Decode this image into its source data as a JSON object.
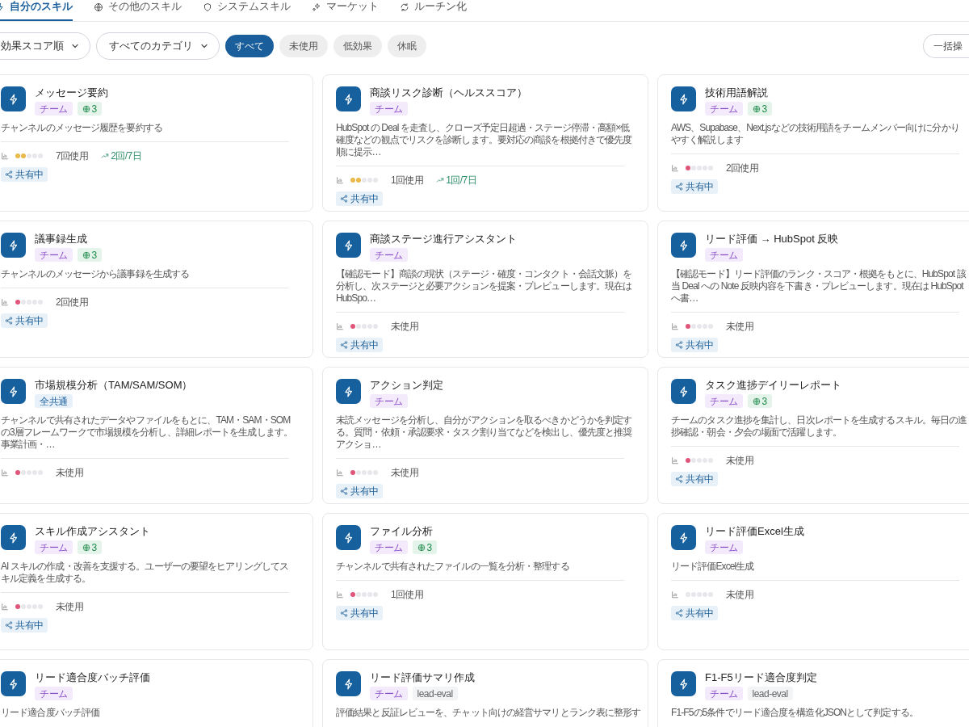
{
  "tabs": [
    {
      "label": "自分のスキル",
      "selected": true
    },
    {
      "label": "その他のスキル",
      "selected": false
    },
    {
      "label": "システムスキル",
      "selected": false
    },
    {
      "label": "マーケット",
      "selected": false
    },
    {
      "label": "ルーチン化",
      "selected": false
    }
  ],
  "toolbar": {
    "sort": {
      "value": "効果スコア順"
    },
    "category": {
      "value": "すべてのカテゴリ"
    },
    "chips": [
      {
        "label": "すべて",
        "selected": true
      },
      {
        "label": "未使用",
        "selected": false
      },
      {
        "label": "低効果",
        "selected": false
      },
      {
        "label": "休眠",
        "selected": false
      }
    ],
    "bulk_button": "一括操"
  },
  "cards": [
    {
      "name": "メッセージ要約",
      "tags": [
        {
          "kind": "team",
          "text": "チーム"
        },
        {
          "kind": "channels",
          "text": "3"
        }
      ],
      "description": "チャンネルのメッセージ履歴を要約する",
      "stars": 2,
      "usage": "7回使用",
      "trend": "2回/7日",
      "shared": true,
      "shared_label": "共有中"
    },
    {
      "name": "商談リスク診断（ヘルススコア）",
      "tags": [
        {
          "kind": "team",
          "text": "チーム"
        }
      ],
      "description": "HubSpot の Deal を走査し、クローズ予定日超過・ステージ停滞・高額×低確度などの観点でリスクを診断します。要対応の商談を根拠付きで優先度順に提示…",
      "stars": 2,
      "usage": "1回使用",
      "trend": "1回/7日",
      "shared": true,
      "shared_label": "共有中"
    },
    {
      "name": "技術用語解説",
      "tags": [
        {
          "kind": "team",
          "text": "チーム"
        },
        {
          "kind": "channels",
          "text": "3"
        }
      ],
      "description": "AWS、Supabase、Next.jsなどの技術用語をチームメンバー向けに分かりやすく解説します",
      "stars": 1,
      "usage": "2回使用",
      "shared": true,
      "shared_label": "共有中"
    },
    {
      "name": "議事録生成",
      "tags": [
        {
          "kind": "team",
          "text": "チーム"
        },
        {
          "kind": "channels",
          "text": "3"
        }
      ],
      "description": "チャンネルのメッセージから議事録を生成する",
      "stars": 1,
      "usage": "2回使用",
      "shared": true,
      "shared_label": "共有中"
    },
    {
      "name": "商談ステージ進行アシスタント",
      "tags": [
        {
          "kind": "team",
          "text": "チーム"
        }
      ],
      "description": "【確認モード】商談の現状（ステージ・確度・コンタクト・会話文脈）を分析し、次ステージと必要アクションを提案・プレビューします。現在は HubSpo…",
      "stars": 1,
      "usage": "未使用",
      "shared": true,
      "shared_label": "共有中"
    },
    {
      "name": "リード評価 → HubSpot 反映",
      "tags": [
        {
          "kind": "team",
          "text": "チーム"
        }
      ],
      "description": "【確認モード】リード評価のランク・スコア・根拠をもとに、HubSpot 該当 Deal への Note 反映内容を下書き・プレビューします。現在は HubSpot へ書…",
      "stars": 1,
      "usage": "未使用",
      "shared": true,
      "shared_label": "共有中"
    },
    {
      "name": "市場規模分析（TAM/SAM/SOM）",
      "tags": [
        {
          "kind": "all",
          "text": "全共通"
        }
      ],
      "description": "チャンネルで共有されたデータやファイルをもとに、TAM・SAM・SOM の3層フレームワークで市場規模を分析し、詳細レポートを生成します。事業計画・…",
      "stars": 1,
      "usage": "未使用",
      "shared": false
    },
    {
      "name": "アクション判定",
      "tags": [
        {
          "kind": "team",
          "text": "チーム"
        }
      ],
      "description": "未読メッセージを分析し、自分がアクションを取るべきかどうかを判定する。質問・依頼・承認要求・タスク割り当てなどを検出し、優先度と推奨アクショ…",
      "stars": 1,
      "usage": "未使用",
      "shared": true,
      "shared_label": "共有中"
    },
    {
      "name": "タスク進捗デイリーレポート",
      "tags": [
        {
          "kind": "team",
          "text": "チーム"
        },
        {
          "kind": "channels",
          "text": "3"
        }
      ],
      "description": "チームのタスク進捗を集計し、日次レポートを生成するスキル。毎日の進捗確認・朝会・夕会の場面で活躍します。",
      "stars": 1,
      "usage": "未使用",
      "shared": true,
      "shared_label": "共有中"
    },
    {
      "name": "スキル作成アシスタント",
      "tags": [
        {
          "kind": "team",
          "text": "チーム"
        },
        {
          "kind": "channels",
          "text": "3"
        }
      ],
      "description": "AI スキルの作成・改善を支援する。ユーザーの要望をヒアリングしてスキル定義を生成する。",
      "stars": 1,
      "usage": "未使用",
      "shared": true,
      "shared_label": "共有中"
    },
    {
      "name": "ファイル分析",
      "tags": [
        {
          "kind": "team",
          "text": "チーム"
        },
        {
          "kind": "channels",
          "text": "3"
        }
      ],
      "description": "チャンネルで共有されたファイルの一覧を分析・整理する",
      "stars": 1,
      "usage": "1回使用",
      "shared": true,
      "shared_label": "共有中"
    },
    {
      "name": "リード評価Excel生成",
      "tags": [
        {
          "kind": "team",
          "text": "チーム"
        }
      ],
      "description": "リード評価Excel生成",
      "stars": 0,
      "usage": "未使用",
      "shared": true,
      "shared_label": "共有中"
    },
    {
      "name": "リード適合度バッチ評価",
      "tags": [
        {
          "kind": "team",
          "text": "チーム"
        }
      ],
      "description": "リード適合度バッチ評価"
    },
    {
      "name": "リード評価サマリ作成",
      "tags": [
        {
          "kind": "team",
          "text": "チーム"
        },
        {
          "kind": "label",
          "text": "lead-eval"
        }
      ],
      "description": "評価結果と反証レビューを、チャット向けの経営サマリとランク表に整形す"
    },
    {
      "name": "F1-F5リード適合度判定",
      "tags": [
        {
          "kind": "team",
          "text": "チーム"
        },
        {
          "kind": "label",
          "text": "lead-eval"
        }
      ],
      "description": "F1-F5の5条件でリード適合度を構造化JSONとして判定する。"
    }
  ]
}
